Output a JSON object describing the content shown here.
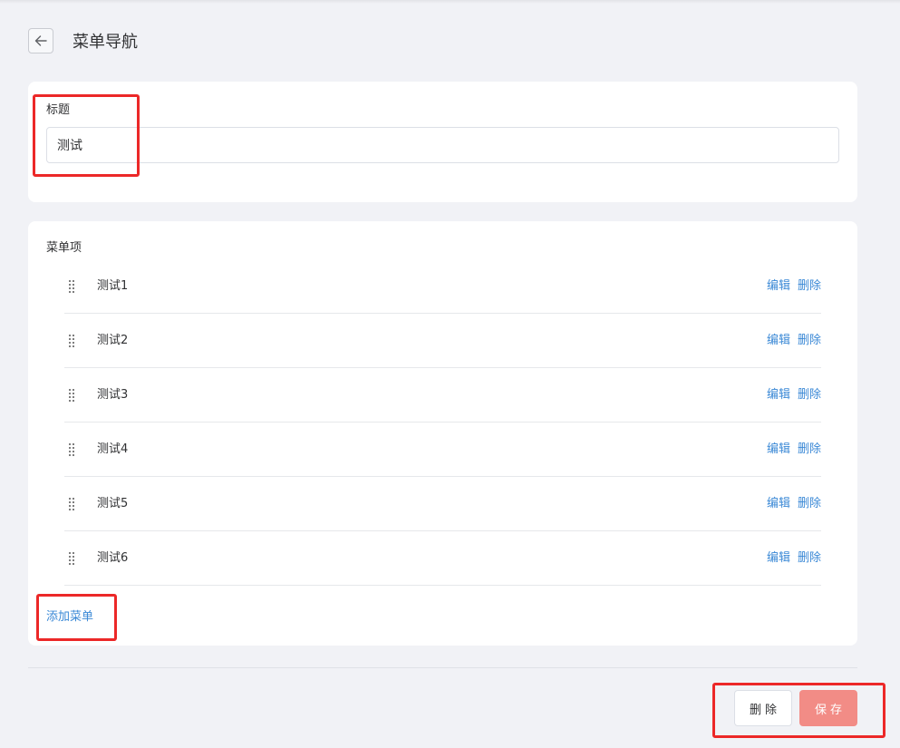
{
  "header": {
    "title": "菜单导航"
  },
  "title_section": {
    "label": "标题",
    "input_value": "测试"
  },
  "menu_section": {
    "label": "菜单项",
    "items": [
      {
        "label": "测试1",
        "edit": "编辑",
        "delete": "删除"
      },
      {
        "label": "测试2",
        "edit": "编辑",
        "delete": "删除"
      },
      {
        "label": "测试3",
        "edit": "编辑",
        "delete": "删除"
      },
      {
        "label": "测试4",
        "edit": "编辑",
        "delete": "删除"
      },
      {
        "label": "测试5",
        "edit": "编辑",
        "delete": "删除"
      },
      {
        "label": "测试6",
        "edit": "编辑",
        "delete": "删除"
      }
    ],
    "add_label": "添加菜单"
  },
  "footer": {
    "delete_label": "删除",
    "save_label": "保存"
  },
  "icons": {
    "back": "arrow-left-icon",
    "drag": "drag-handle-icon"
  },
  "colors": {
    "link": "#3b89d6",
    "save_button": "#f28c86",
    "highlight": "#ec2828",
    "background": "#f1f2f6"
  }
}
